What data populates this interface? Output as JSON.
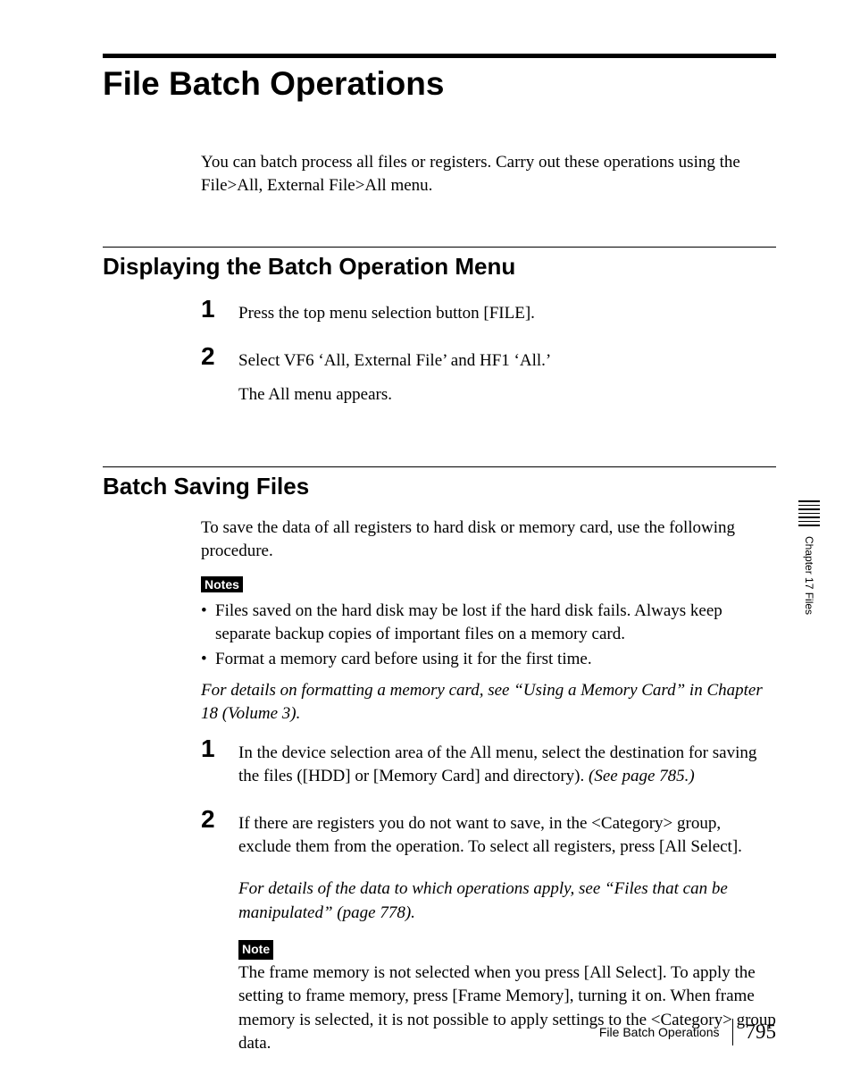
{
  "title": "File Batch Operations",
  "intro": "You can batch process all files or registers. Carry out these operations using the File>All, External File>All menu.",
  "section1": {
    "title": "Displaying the Batch Operation Menu",
    "steps": {
      "s1": {
        "num": "1",
        "text": "Press the top menu selection button [FILE]."
      },
      "s2": {
        "num": "2",
        "text": "Select VF6 ‘All, External File’ and HF1 ‘All.’",
        "follow": "The All menu appears."
      }
    }
  },
  "section2": {
    "title": "Batch Saving Files",
    "intro": "To save the data of all registers to hard disk or memory card, use the following procedure.",
    "notes_label": "Notes",
    "bullets": {
      "b1": "Files saved on the hard disk may be lost if the hard disk fails. Always keep separate backup copies of important files on a memory card.",
      "b2": "Format a memory card before using it for the first time."
    },
    "ref": "For details on formatting a memory card, see “Using a Memory Card” in Chapter 18 (Volume 3).",
    "steps": {
      "s1": {
        "num": "1",
        "text_a": "In the device selection area of the All menu, select the destination for saving the files ([HDD] or [Memory Card] and directory). ",
        "text_b": "(See page 785.)"
      },
      "s2": {
        "num": "2",
        "text": "If there are registers you do not want to save, in the <Category> group, exclude them from the operation. To select all registers, press [All Select].",
        "ref": "For details of the data to which operations apply, see “Files that can be manipulated” (page 778).",
        "note_label": "Note",
        "note_text": "The frame memory is not selected when you press [All Select]. To apply the setting to frame memory, press [Frame Memory], turning it on. When frame memory is selected, it is not possible to apply settings to the <Category> group data."
      }
    }
  },
  "footer": {
    "title": "File Batch Operations",
    "page": "795"
  },
  "side_tab": "Chapter 17  Files"
}
